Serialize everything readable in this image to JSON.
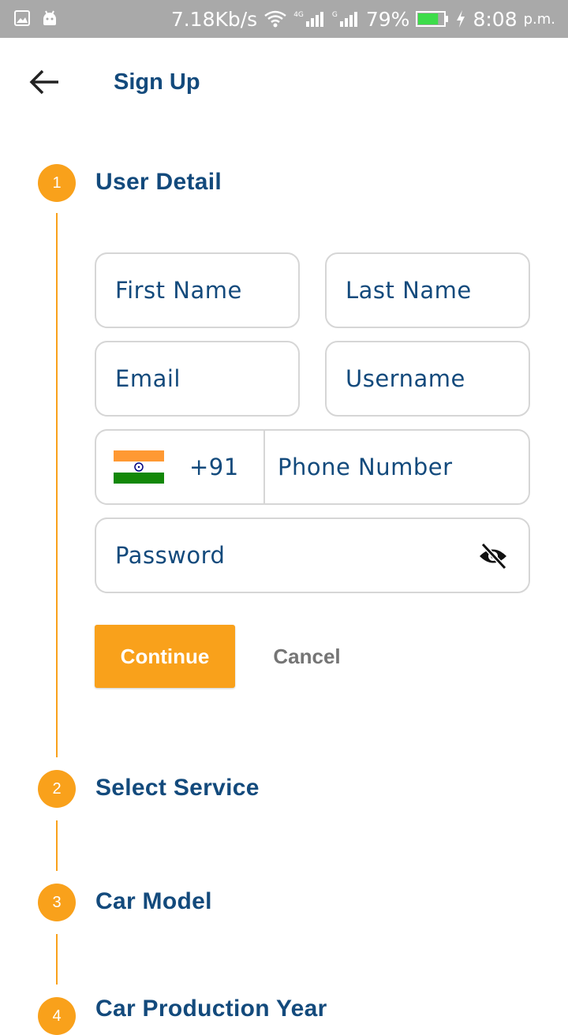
{
  "status_bar": {
    "speed": "7.18Kb/s",
    "net1": "4G",
    "net2": "G",
    "battery": "79%",
    "time": "8:08",
    "ampm": "p.m.",
    "battery_level": 0.79,
    "battery_color": "#3ddc4a"
  },
  "app_bar": {
    "title": "Sign Up"
  },
  "steps": [
    {
      "number": "1",
      "title": "User Detail"
    },
    {
      "number": "2",
      "title": "Select Service"
    },
    {
      "number": "3",
      "title": "Car Model"
    },
    {
      "number": "4",
      "title": "Car Production Year"
    }
  ],
  "form": {
    "first_name": "First Name",
    "last_name": "Last Name",
    "email": "Email",
    "username": "Username",
    "country_code": "+91",
    "phone": "Phone Number",
    "password": "Password"
  },
  "buttons": {
    "continue": "Continue",
    "cancel": "Cancel"
  },
  "colors": {
    "accent": "#f9a11b",
    "primary": "#134a7c",
    "status_bar": "#a9a9a9"
  }
}
